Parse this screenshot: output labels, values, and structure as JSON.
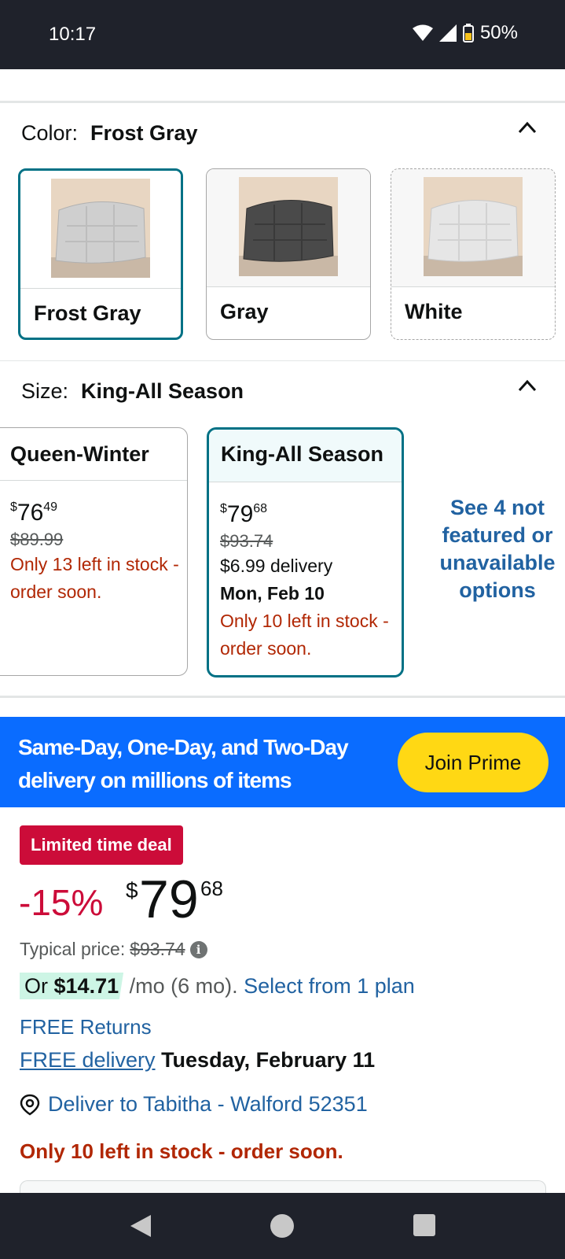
{
  "status_bar": {
    "time": "10:17",
    "battery": "50%"
  },
  "color_section": {
    "label": "Color:",
    "value": "Frost Gray",
    "options": [
      {
        "name": "Frost Gray",
        "swatch": "#cfcfcf"
      },
      {
        "name": "Gray",
        "swatch": "#4a4a4a"
      },
      {
        "name": "White",
        "swatch": "#e6e6e6"
      }
    ]
  },
  "size_section": {
    "label": "Size:",
    "value": "King-All Season",
    "options": [
      {
        "name": "Queen-Winter",
        "price_dollar": "$",
        "price_whole": "76",
        "price_fraction": "49",
        "list_price": "$89.99",
        "stock": "Only 13 left in stock - order soon."
      },
      {
        "name": "King-All Season",
        "price_dollar": "$",
        "price_whole": "79",
        "price_fraction": "68",
        "list_price": "$93.74",
        "delivery": "$6.99 delivery",
        "delivery_date": "Mon, Feb 10",
        "stock": "Only 10 left in stock - order soon."
      }
    ],
    "see_more": "See 4 not featured or unavailable options"
  },
  "prime_banner": {
    "text": "Same-Day, One-Day, and Two-Day delivery on millions of items",
    "button": "Join Prime"
  },
  "buybox": {
    "deal_badge": "Limited time deal",
    "discount": "-15%",
    "price_dollar": "$",
    "price_whole": "79",
    "price_fraction": "68",
    "typical_label": "Typical price:",
    "typical_price": "$93.74",
    "installment_or": "Or",
    "installment_amount": "$14.71",
    "installment_term": " /mo (6 mo).",
    "installment_link": "Select from 1 plan",
    "free_returns": "FREE Returns",
    "free_delivery_link": "FREE delivery",
    "free_delivery_date": "Tuesday, February 11",
    "deliver_to": "Deliver to Tabitha - Walford 52351",
    "stock": "Only 10 left in stock - order soon."
  },
  "colors": {
    "teal_selected": "#007185",
    "prime_blue": "#0a6cff",
    "prime_button": "#ffd814",
    "deal_red": "#cc0c39",
    "stock_red": "#b12704",
    "link_blue": "#2162a1"
  }
}
